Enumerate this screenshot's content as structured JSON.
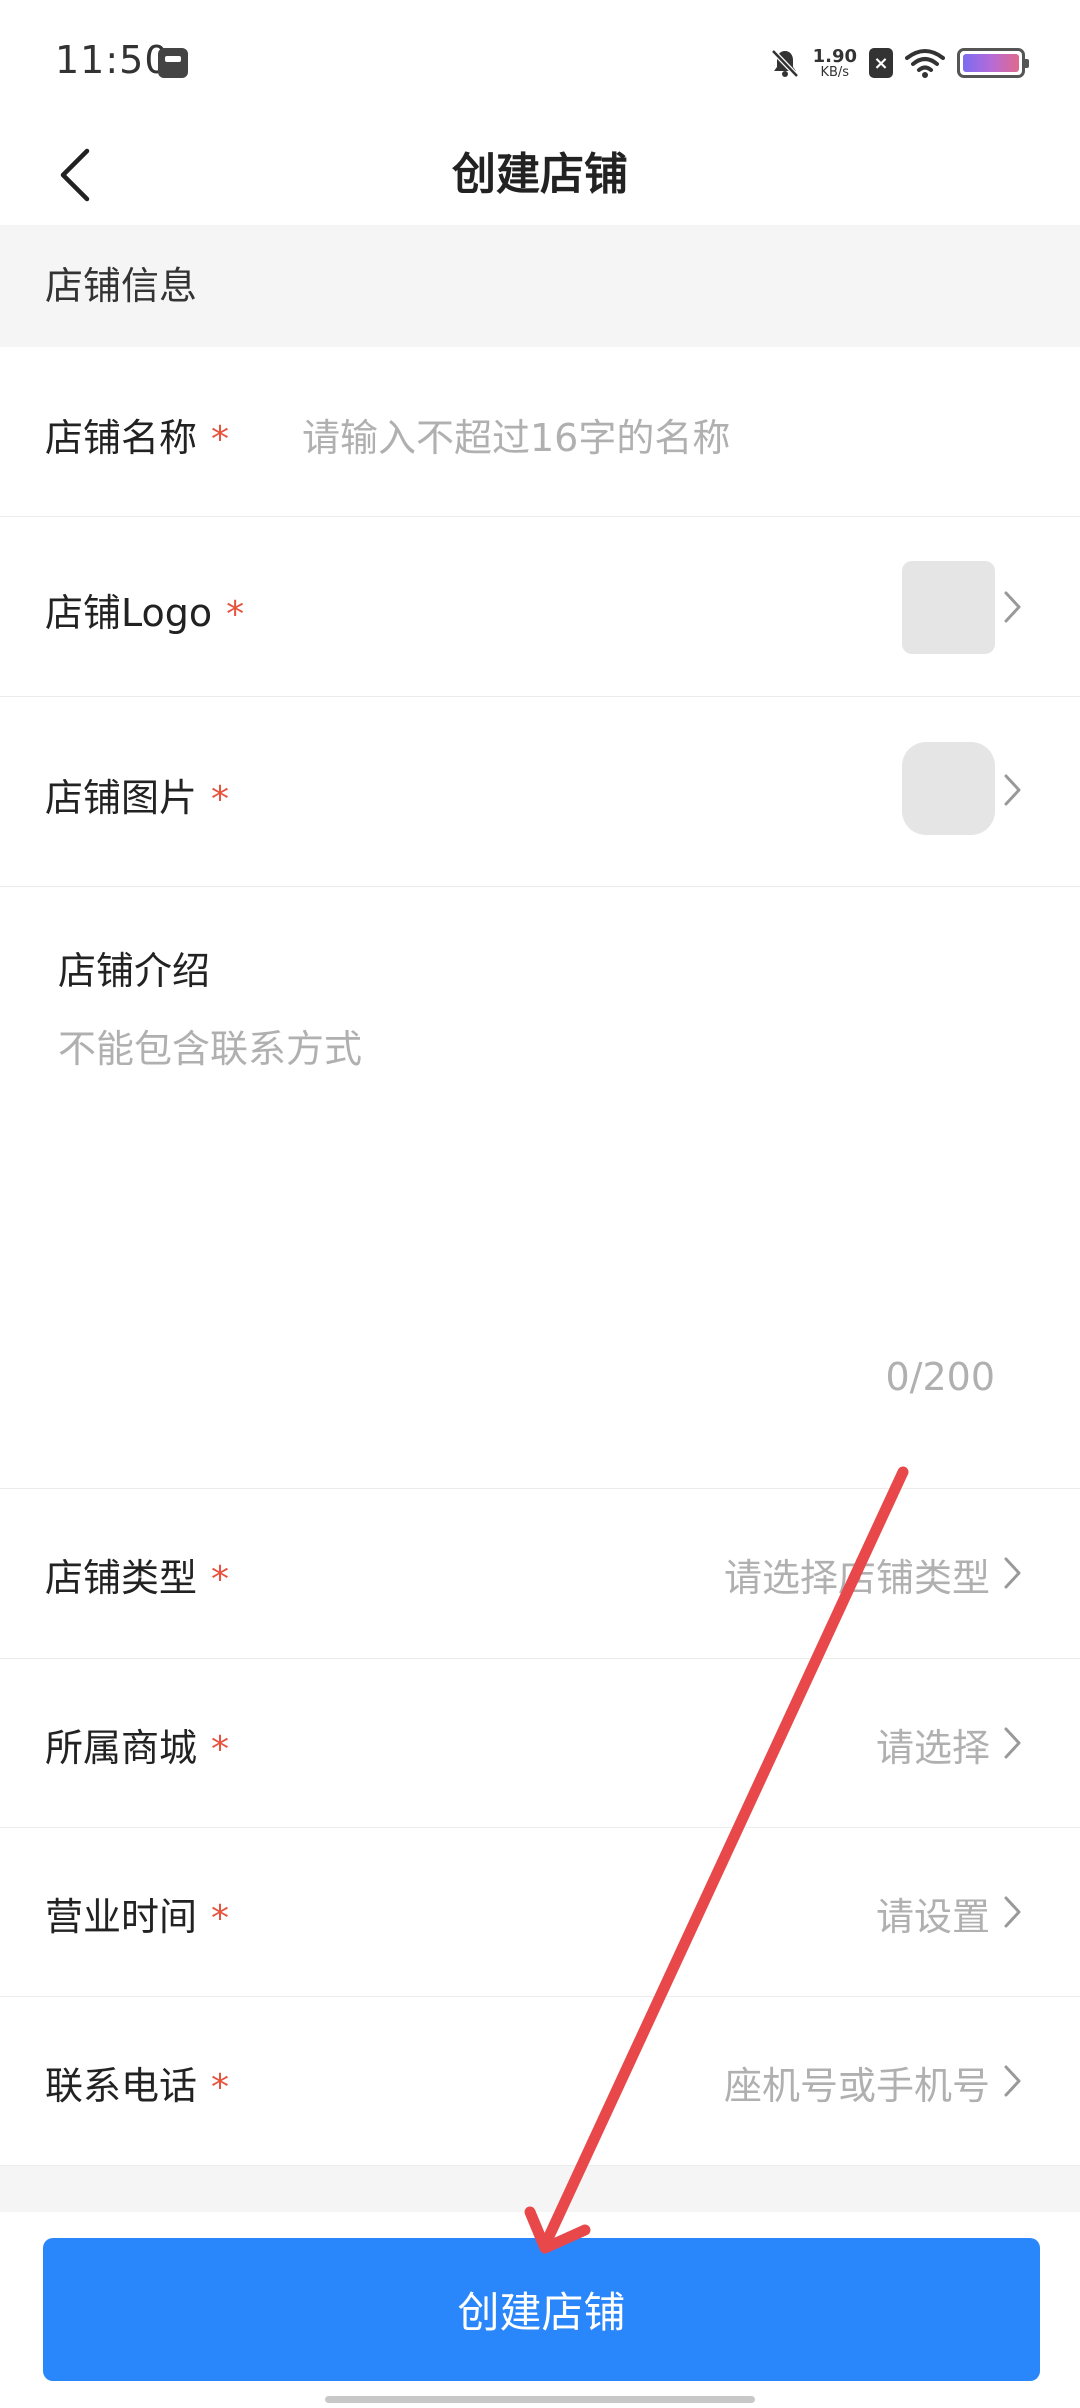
{
  "status_bar": {
    "time": "11:50",
    "net_speed_value": "1.90",
    "net_speed_unit": "KB/s",
    "icons": [
      "app-notification-icon",
      "mute-icon",
      "no-sim-icon",
      "wifi-icon",
      "battery-icon"
    ]
  },
  "nav": {
    "title": "创建店铺",
    "back_icon": "chevron-left-icon"
  },
  "section": {
    "title": "店铺信息"
  },
  "form": {
    "required_mark": "*",
    "name": {
      "label": "店铺名称",
      "placeholder": "请输入不超过16字的名称"
    },
    "logo": {
      "label": "店铺Logo"
    },
    "image": {
      "label": "店铺图片"
    },
    "intro": {
      "label": "店铺介绍",
      "placeholder": "不能包含联系方式",
      "count": "0/200"
    },
    "type": {
      "label": "店铺类型",
      "value": "请选择店铺类型"
    },
    "mall": {
      "label": "所属商城",
      "value": "请选择"
    },
    "hours": {
      "label": "营业时间",
      "value": "请设置"
    },
    "phone": {
      "label": "联系电话",
      "value": "座机号或手机号"
    }
  },
  "submit": {
    "label": "创建店铺"
  },
  "colors": {
    "primary": "#2a86fb",
    "required": "#e8533f",
    "annotation_arrow": "#e8484a"
  }
}
